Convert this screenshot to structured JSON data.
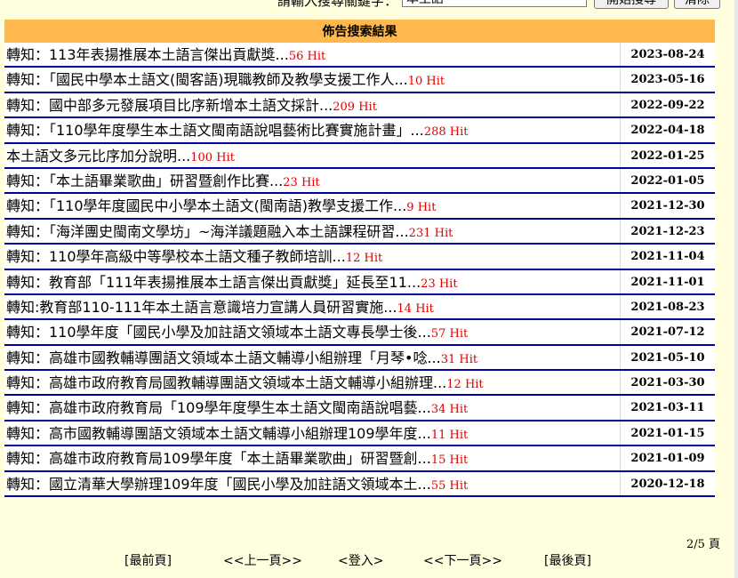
{
  "search": {
    "prompt": "請輸入搜尋關鍵字：",
    "value": "本土語",
    "search_button": "開始搜尋",
    "clear_button": "清除"
  },
  "header": {
    "title": "佈告搜索結果"
  },
  "rows": [
    {
      "title": "轉知：113年表揚推展本土語言傑出貢獻獎...",
      "hit": "56 Hit",
      "date": "2023-08-24"
    },
    {
      "title": "轉知：「國民中學本土語文(閩客語)現職教師及教學支援工作人...",
      "hit": "10 Hit",
      "date": "2023-05-16"
    },
    {
      "title": "轉知：國中部多元發展項目比序新增本土語文採計...",
      "hit": "209 Hit",
      "date": "2022-09-22"
    },
    {
      "title": "轉知：「110學年度學生本土語文閩南語說唱藝術比賽實施計畫」...",
      "hit": "288 Hit",
      "date": "2022-04-18"
    },
    {
      "title": "本土語文多元比序加分說明...",
      "hit": "100 Hit",
      "date": "2022-01-25"
    },
    {
      "title": "轉知：「本土語畢業歌曲」研習暨創作比賽...",
      "hit": "23 Hit",
      "date": "2022-01-05"
    },
    {
      "title": "轉知：「110學年度國民中小學本土語文(閩南語)教學支援工作...",
      "hit": "9 Hit",
      "date": "2021-12-30"
    },
    {
      "title": "轉知：「海洋團史閩南文學坊」~海洋議題融入本土語課程研習...",
      "hit": "231 Hit",
      "date": "2021-12-23"
    },
    {
      "title": "轉知：110學年高級中等學校本土語文種子教師培訓...",
      "hit": "12 Hit",
      "date": "2021-11-04"
    },
    {
      "title": "轉知：教育部「111年表揚推展本土語言傑出貢獻獎」延長至11...",
      "hit": "23 Hit",
      "date": "2021-11-01"
    },
    {
      "title": "轉知:教育部110-111年本土語言意識培力宣講人員研習實施...",
      "hit": "14 Hit",
      "date": "2021-08-23"
    },
    {
      "title": "轉知：110學年度「國民小學及加註語文領域本土語文專長學士後...",
      "hit": "57 Hit",
      "date": "2021-07-12"
    },
    {
      "title": "轉知：高雄市國教輔導團語文領域本土語文輔導小組辦理「月琴•唸...",
      "hit": "31 Hit",
      "date": "2021-05-10"
    },
    {
      "title": "轉知：高雄市政府教育局國教輔導團語文領域本土語文輔導小組辦理...",
      "hit": "12 Hit",
      "date": "2021-03-30"
    },
    {
      "title": "轉知：高雄市政府教育局「109學年度學生本土語文閩南語說唱藝...",
      "hit": "34 Hit",
      "date": "2021-03-11"
    },
    {
      "title": "轉知：高市國教輔導團語文領域本土語文輔導小組辦理109學年度...",
      "hit": "11 Hit",
      "date": "2021-01-15"
    },
    {
      "title": "轉知：高雄市政府教育局109學年度「本土語畢業歌曲」研習暨創...",
      "hit": "15 Hit",
      "date": "2021-01-09"
    },
    {
      "title": "轉知：國立清華大學辦理109年度「國民小學及加註語文領域本土...",
      "hit": "55 Hit",
      "date": "2020-12-18"
    }
  ],
  "pagination": {
    "page_info": "2/5 頁",
    "first": "[最前頁]",
    "prev": "<<上一頁>>",
    "login": "<登入>",
    "next": "<<下一頁>>",
    "last": "[最後頁]"
  }
}
